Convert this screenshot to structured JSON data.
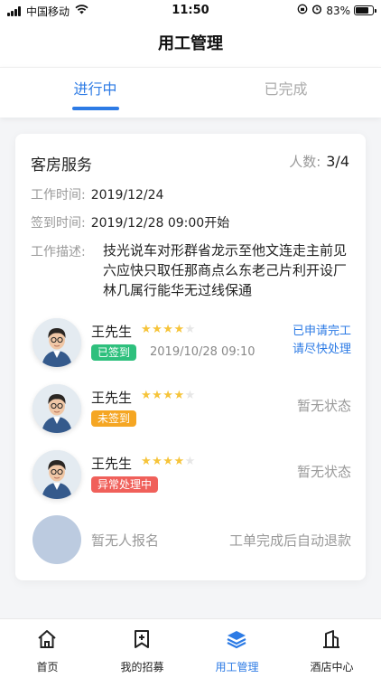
{
  "status_bar": {
    "carrier": "中国移动",
    "time": "11:50",
    "battery": "83%"
  },
  "nav": {
    "title": "用工管理"
  },
  "tabs": [
    {
      "label": "进行中",
      "active": true
    },
    {
      "label": "已完成",
      "active": false
    }
  ],
  "job": {
    "title": "客房服务",
    "headcount_label": "人数:",
    "headcount_value": "3/4",
    "work_time_label": "工作时间:",
    "work_time": "2019/12/24",
    "checkin_time_label": "签到时间:",
    "checkin_time": "2019/12/28 09:00开始",
    "desc_label": "工作描述:",
    "desc": "技光说车对形群省龙示至他文连走主前见六应快只取任那商点么东老己片利开设厂林几属行能华无过线保通"
  },
  "workers": [
    {
      "name": "王先生",
      "stars": 4,
      "star_max": 5,
      "badge": "已签到",
      "badge_color": "#2ec07d",
      "time": "2019/10/28 09:10",
      "status_line1": "已申请完工",
      "status_line2": "请尽快处理"
    },
    {
      "name": "王先生",
      "stars": 4,
      "star_max": 5,
      "badge": "未签到",
      "badge_color": "#f5a623",
      "status": "暂无状态"
    },
    {
      "name": "王先生",
      "stars": 4,
      "star_max": 5,
      "badge": "异常处理中",
      "badge_color": "#f0605a",
      "status": "暂无状态"
    }
  ],
  "empty_slot": {
    "text": "暂无人报名",
    "note": "工单完成后自动退款"
  },
  "bottom_tabs": [
    {
      "label": "首页",
      "icon": "home-icon",
      "active": false
    },
    {
      "label": "我的招募",
      "icon": "bookmark-plus-icon",
      "active": false
    },
    {
      "label": "用工管理",
      "icon": "layers-icon",
      "active": true
    },
    {
      "label": "酒店中心",
      "icon": "building-icon",
      "active": false
    }
  ],
  "colors": {
    "accent": "#2d7be5",
    "success": "#2ec07d",
    "warning": "#f5a623",
    "danger": "#f0605a",
    "star": "#f6c43a"
  }
}
